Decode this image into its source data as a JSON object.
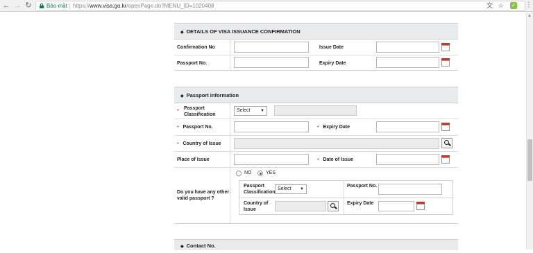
{
  "browser": {
    "secure_label": "Bảo mật",
    "url_scheme": "https://",
    "url_host": "www.visa.go.kr",
    "url_path": "/openPage.do?MENU_ID=1020408"
  },
  "visa_issuance": {
    "title": "DETAILS OF VISA ISSUANCE CONFIRMATION",
    "confirmation_no_label": "Confirmation No",
    "issue_date_label": "Issue Date",
    "passport_no_label": "Passport No.",
    "expiry_date_label": "Expiry Date"
  },
  "passport_info": {
    "title": "Passport information",
    "classification_label": "Passport Classification",
    "classification_value": "Select",
    "passport_no_label": "Passport No.",
    "expiry_date_label": "Expiry Date",
    "country_label": "Country of Issue",
    "place_label": "Place of Issue",
    "date_of_issue_label": "Date of Issue",
    "other_passport_question": "Do you have any other valid passport ?",
    "radio_no": "NO",
    "radio_yes": "YES",
    "radio_selected": "YES",
    "other": {
      "classification_label": "Passport Classification",
      "classification_value": "Select",
      "passport_no_label": "Passport No.",
      "country_label": "Country of Issue",
      "expiry_label": "Expiry Date"
    }
  },
  "contact": {
    "title": "Contact No."
  },
  "colors": {
    "header_bg": "#e9eaeb",
    "required": "#d44444",
    "secure_green": "#0b8043"
  }
}
